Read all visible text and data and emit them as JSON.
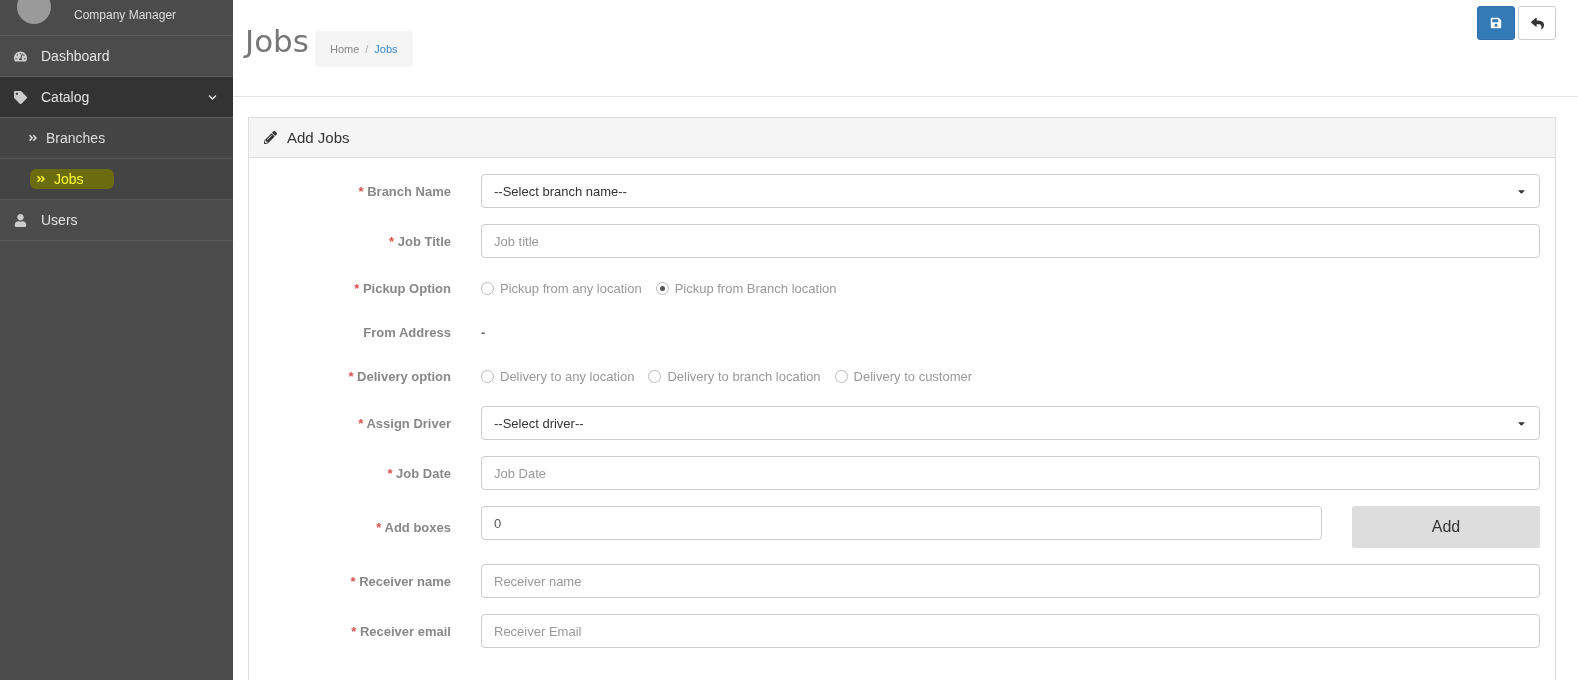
{
  "sidebar": {
    "user_role": "Company Manager",
    "items": [
      {
        "label": "Dashboard",
        "expanded": false
      },
      {
        "label": "Catalog",
        "expanded": true,
        "children": [
          {
            "label": "Branches",
            "selected": false
          },
          {
            "label": "Jobs",
            "selected": true
          }
        ]
      },
      {
        "label": "Users",
        "expanded": false
      }
    ]
  },
  "header": {
    "title": "Jobs",
    "separator": "/",
    "breadcrumb": [
      {
        "label": "Home",
        "selected": false
      },
      {
        "label": "Jobs",
        "selected": true
      }
    ]
  },
  "panel": {
    "title": "Add Jobs",
    "fields": [
      {
        "kind": "select",
        "label": "Branch Name",
        "marker": "*",
        "value": "--Select branch name--"
      },
      {
        "kind": "text",
        "label": "Job Title",
        "marker": "*",
        "placeholder": "Job title"
      },
      {
        "kind": "radio",
        "label": "Pickup Option",
        "marker": "*",
        "options": [
          {
            "label": "Pickup from any location",
            "selected": false
          },
          {
            "label": "Pickup from Branch location",
            "selected": true
          }
        ]
      },
      {
        "kind": "static",
        "label": "From Address",
        "value": "-"
      },
      {
        "kind": "radio",
        "label": "Delivery option",
        "marker": "*",
        "options": [
          {
            "label": "Delivery to any location",
            "selected": false
          },
          {
            "label": "Delivery to branch location",
            "selected": false
          },
          {
            "label": "Delivery to customer",
            "selected": false
          }
        ]
      },
      {
        "kind": "select",
        "label": "Assign Driver",
        "marker": "*",
        "value": "--Select driver--"
      },
      {
        "kind": "text",
        "label": "Job Date",
        "marker": "*",
        "placeholder": "Job Date"
      },
      {
        "kind": "text_button",
        "label": "Add boxes",
        "marker": "*",
        "value": "0",
        "button": "Add"
      },
      {
        "kind": "text",
        "label": "Receiver name",
        "marker": "*",
        "placeholder": "Receiver name"
      },
      {
        "kind": "text",
        "label": "Receiver email",
        "marker": "*",
        "placeholder": "Receiver Email"
      }
    ]
  }
}
